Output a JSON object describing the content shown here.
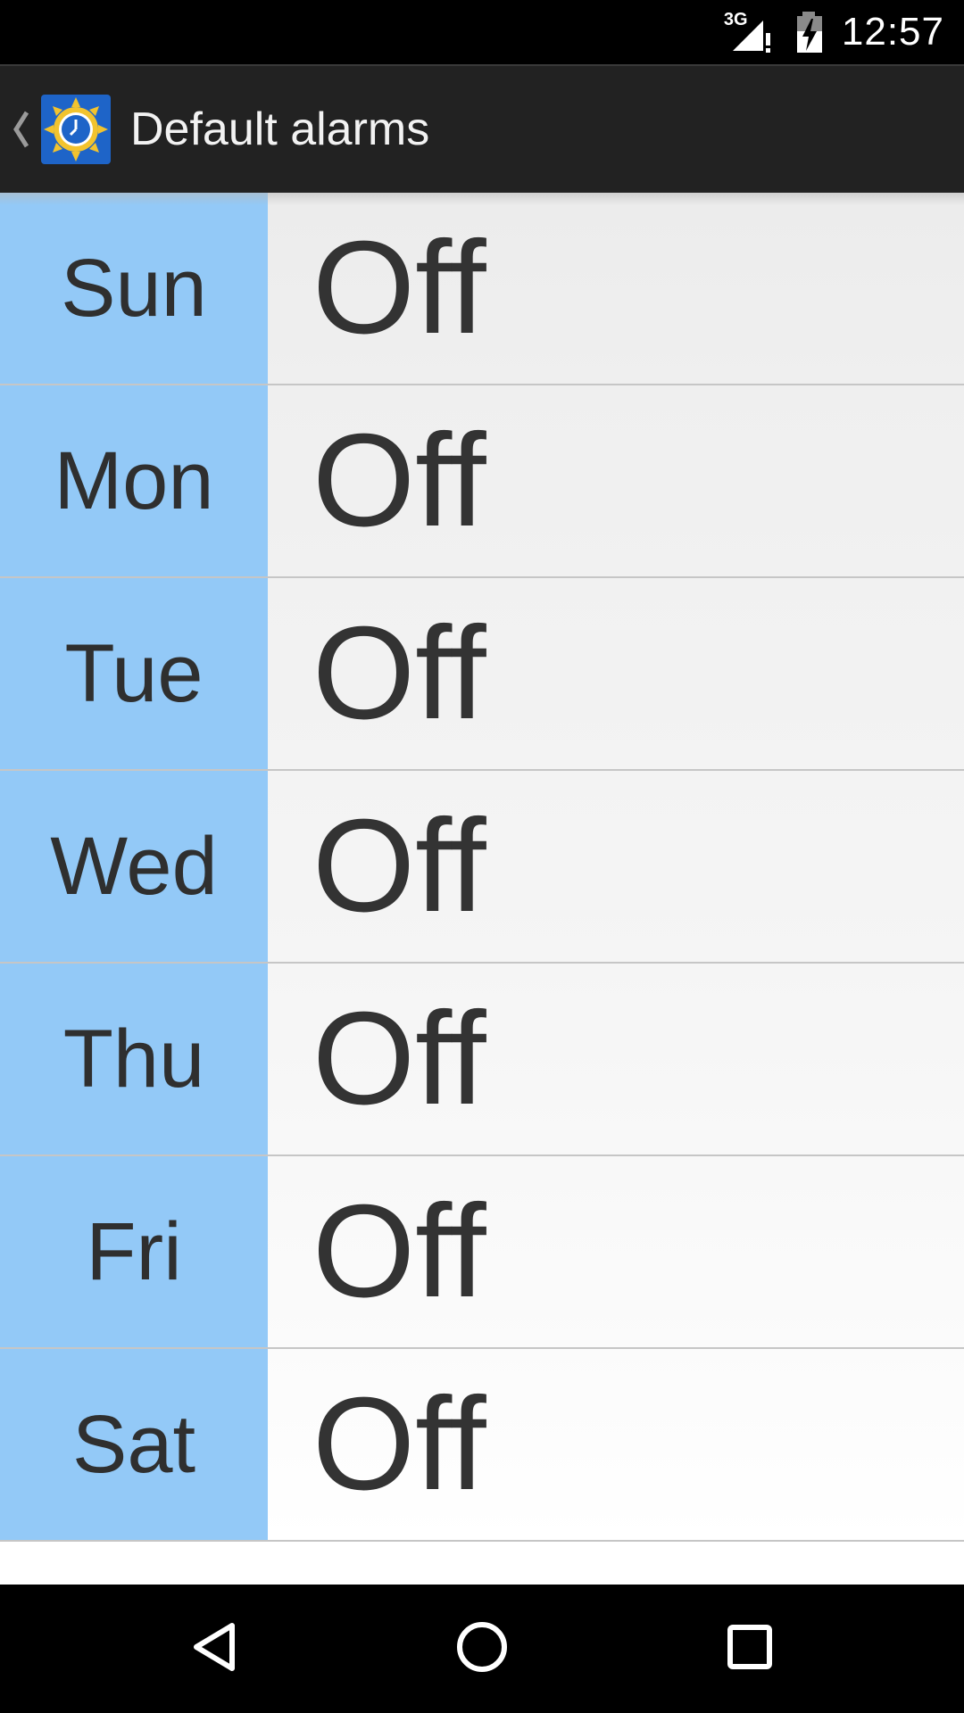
{
  "status_bar": {
    "network": "3G",
    "time": "12:57",
    "icons": [
      "signal-3g-icon",
      "battery-charging-icon"
    ]
  },
  "action_bar": {
    "title": "Default alarms",
    "up_icon": "chevron-left-icon",
    "app_icon": "sun-clock-app-icon"
  },
  "alarms": [
    {
      "day": "Sun",
      "value": "Off"
    },
    {
      "day": "Mon",
      "value": "Off"
    },
    {
      "day": "Tue",
      "value": "Off"
    },
    {
      "day": "Wed",
      "value": "Off"
    },
    {
      "day": "Thu",
      "value": "Off"
    },
    {
      "day": "Fri",
      "value": "Off"
    },
    {
      "day": "Sat",
      "value": "Off"
    }
  ],
  "nav_bar": {
    "icons": [
      "back-icon",
      "home-icon",
      "recents-icon"
    ]
  },
  "colors": {
    "day_column": "#93c9f7",
    "action_bar": "#222222",
    "value_gradient_top": "#ececec",
    "value_gradient_bottom": "#ffffff",
    "app_icon_bg": "#1e64c8",
    "app_icon_sun": "#f2c32e"
  }
}
